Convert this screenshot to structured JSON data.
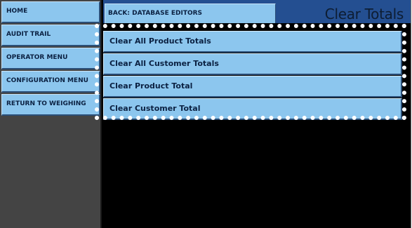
{
  "sidebar": {
    "items": [
      {
        "label": "HOME"
      },
      {
        "label": "AUDIT TRAIL"
      },
      {
        "label": "OPERATOR MENU"
      },
      {
        "label": "CONFIGURATION MENU"
      },
      {
        "label": "RETURN TO WEIGHING"
      }
    ]
  },
  "header": {
    "back_label": "BACK: DATABASE EDITORS",
    "title": "Clear Totals"
  },
  "menu": {
    "items": [
      {
        "label": "Clear All Product Totals"
      },
      {
        "label": "Clear All Customer Totals"
      },
      {
        "label": "Clear Product Total"
      },
      {
        "label": "Clear Customer Total"
      }
    ]
  },
  "colors": {
    "button_face": "#8cc6ee",
    "button_text": "#0b2142",
    "header_bar": "#244f91",
    "sidebar_bg": "#444444",
    "content_bg": "#000000",
    "highlight_outline": "#ffffff"
  }
}
